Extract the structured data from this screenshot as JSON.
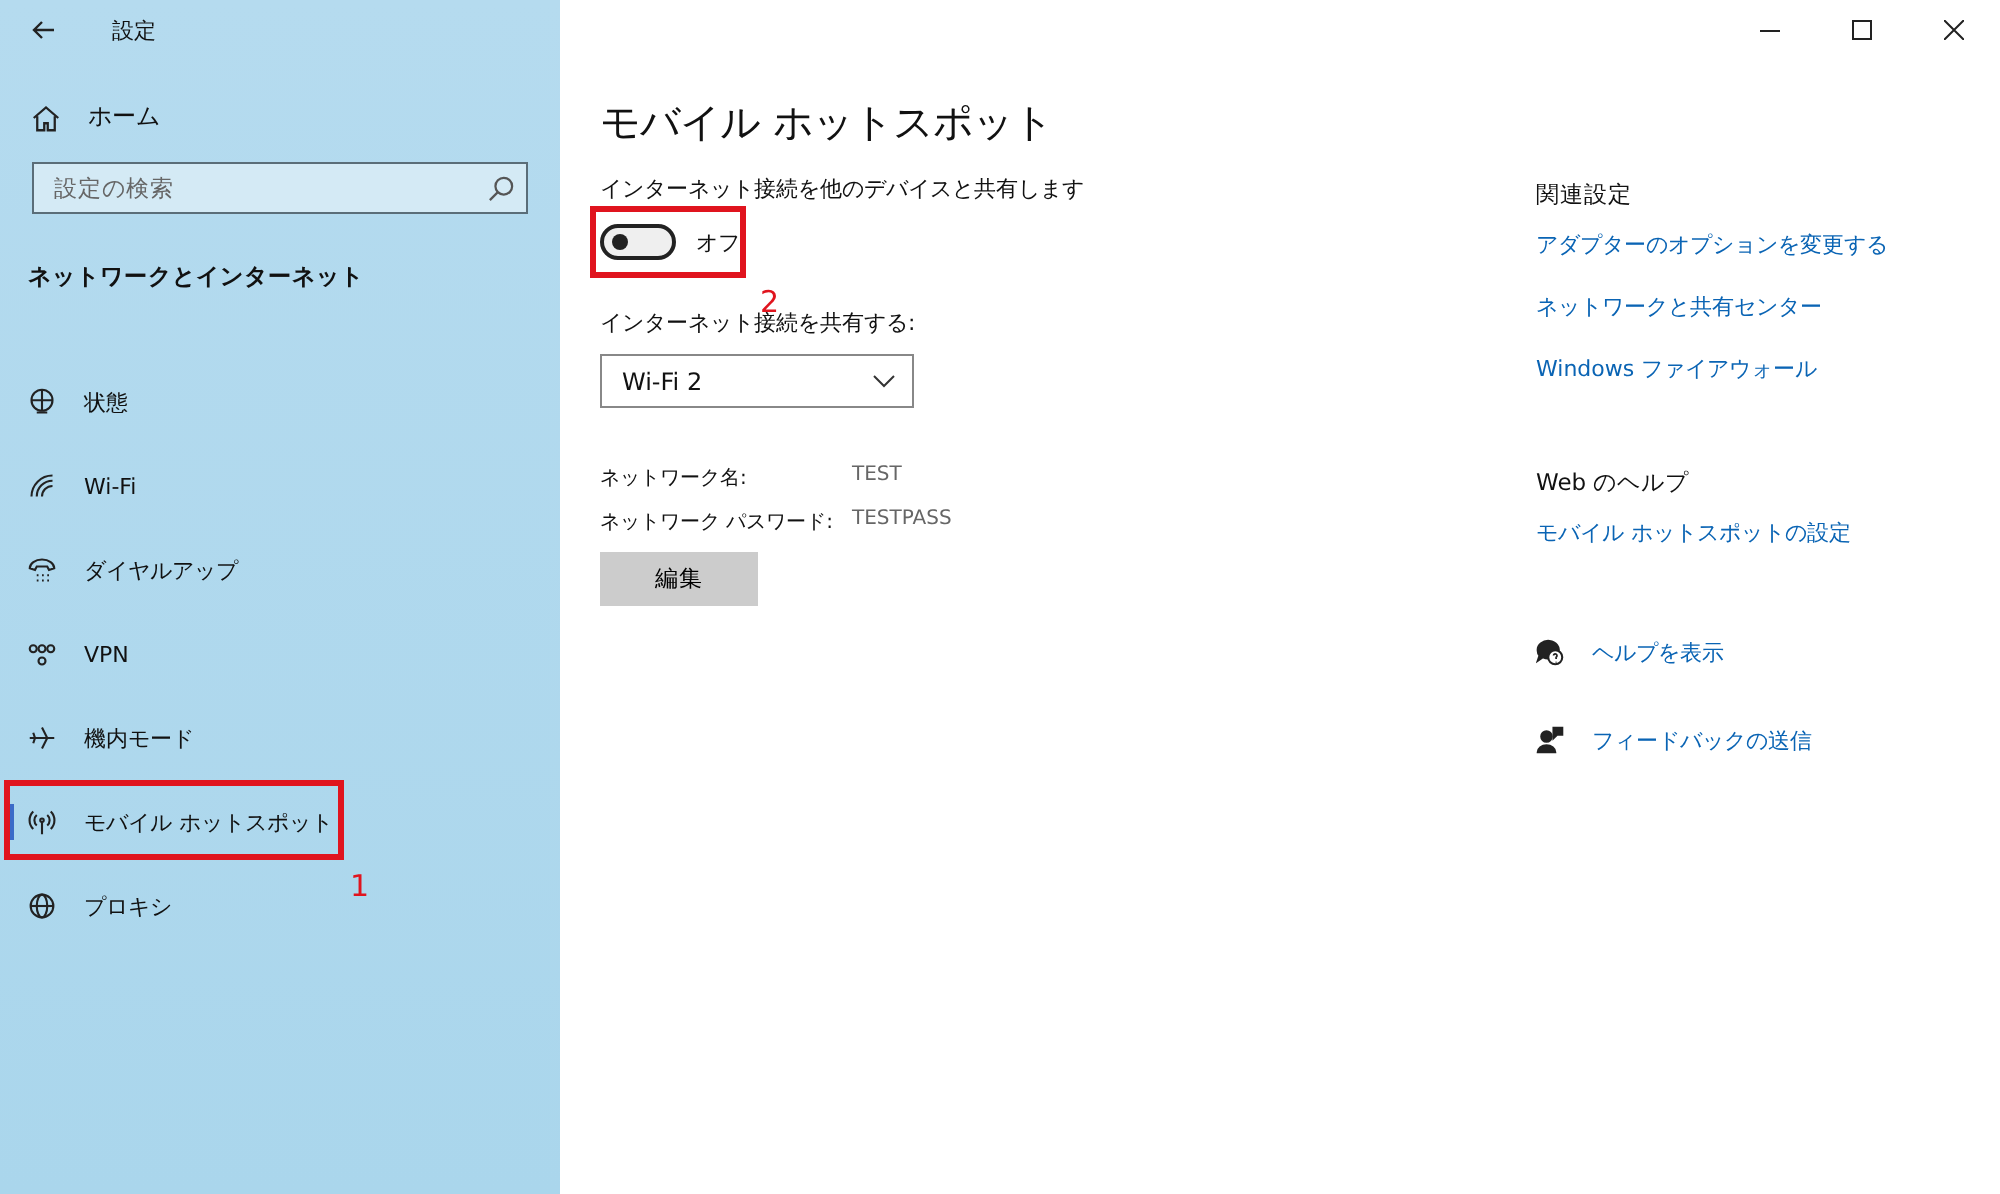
{
  "window": {
    "title": "設定"
  },
  "sidebar": {
    "home": "ホーム",
    "search": {
      "placeholder": "設定の検索"
    },
    "section": "ネットワークとインターネット",
    "items": [
      {
        "kind": "status",
        "label": "状態",
        "selected": false
      },
      {
        "kind": "wifi",
        "label": "Wi-Fi",
        "selected": false
      },
      {
        "kind": "dialup",
        "label": "ダイヤルアップ",
        "selected": false
      },
      {
        "kind": "vpn",
        "label": "VPN",
        "selected": false
      },
      {
        "kind": "airplane",
        "label": "機内モード",
        "selected": false
      },
      {
        "kind": "hotspot",
        "label": "モバイル ホットスポット",
        "selected": true,
        "annotation": "1"
      },
      {
        "kind": "proxy",
        "label": "プロキシ",
        "selected": false
      }
    ]
  },
  "main": {
    "title": "モバイル ホットスポット",
    "share_label": "インターネット接続を他のデバイスと共有します",
    "toggle": {
      "on": false,
      "label": "オフ",
      "annotation": "2"
    },
    "source_label": "インターネット接続を共有する:",
    "source": {
      "value": "Wi-Fi 2"
    },
    "details": [
      {
        "name": "ネットワーク名:",
        "value": "TEST"
      },
      {
        "name": "ネットワーク パスワード:",
        "value": "TESTPASS"
      }
    ],
    "edit_button": "編集"
  },
  "related": {
    "title": "関連設定",
    "links": [
      "アダプターのオプションを変更する",
      "ネットワークと共有センター",
      "Windows ファイアウォール"
    ],
    "web_help_title": "Web のヘルプ",
    "web_help_links": [
      "モバイル ホットスポットの設定"
    ],
    "actions": [
      {
        "kind": "help",
        "label": "ヘルプを表示"
      },
      {
        "kind": "feedback",
        "label": "フィードバックの送信"
      }
    ]
  }
}
